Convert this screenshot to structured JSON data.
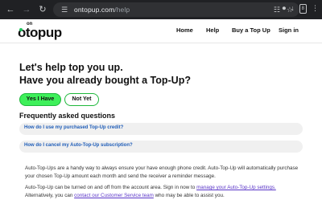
{
  "browser": {
    "url_host": "ontopup.com",
    "url_path": "/help",
    "tab_count": "8"
  },
  "header": {
    "logo_small": "on",
    "logo_main": "topup",
    "nav": [
      {
        "label": "Home"
      },
      {
        "label": "Help"
      },
      {
        "label": "Buy a Top Up"
      },
      {
        "label": "Sign in"
      }
    ]
  },
  "main": {
    "headline_line1": "Let's help top you up.",
    "headline_line2": "Have you already bought a Top-Up?",
    "yes_button": "Yes I Have",
    "no_button": "Not Yet",
    "faq_title": "Frequently asked questions",
    "faq_items": [
      {
        "question": "How do I use my purchased Top-Up credit?"
      },
      {
        "question": "How do I cancel my Auto-Top-Up subscription?"
      }
    ],
    "para1": "Auto-Top-Ups are a handy way to always ensure your have enough phone credit. Auto-Top-Up will automatically purchase your chosen Top-Up amount each month and send the receiver a reminder message.",
    "para2_text1": "Auto-Top-Up can be turned on and off from the account area. Sign in now to ",
    "para2_link1": "manage your Auto-Top-Up settings.",
    "para2_text2": " Alternatively, you can ",
    "para2_link2": "contact our Customer Service team",
    "para2_text3": " who may be able to assist you."
  },
  "colors": {
    "accent_green": "#3ef05a",
    "link_blue": "#1f5db8",
    "link_purple": "#5a35c8"
  }
}
